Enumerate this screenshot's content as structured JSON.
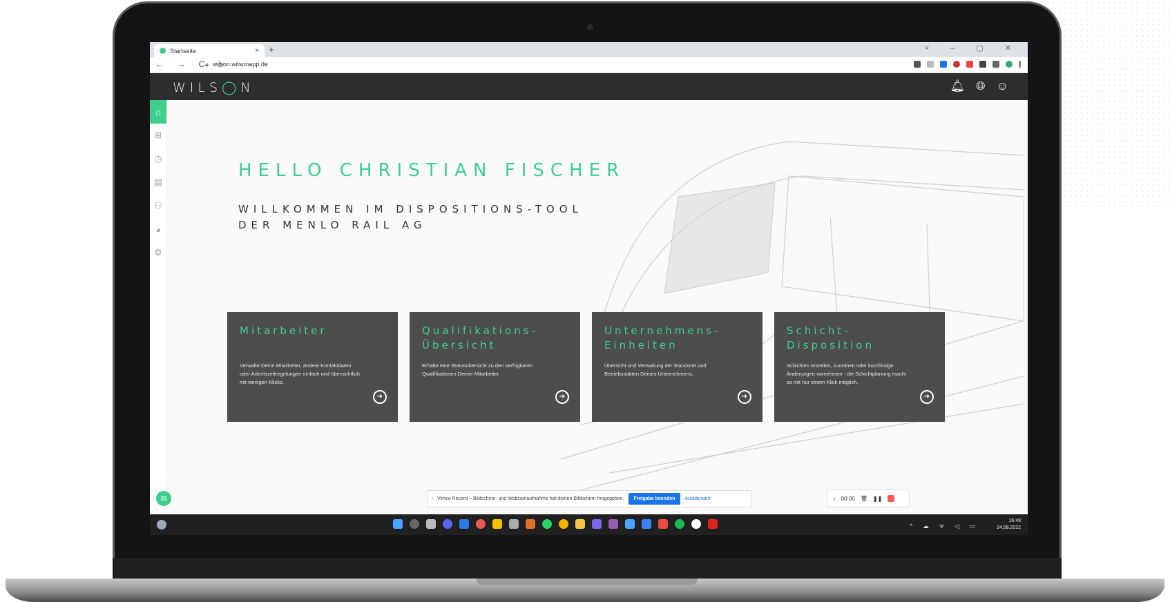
{
  "browser": {
    "tab_title": "Startseite",
    "tab_close": "×",
    "new_tab": "+",
    "url": "wilson.wilsonapp.de",
    "nav": "← → C ⌂",
    "window_controls": "˅ – ▢ ✕"
  },
  "app": {
    "logo_pre": "WILS",
    "logo_o": "◯",
    "logo_post": "N"
  },
  "main": {
    "greeting": "HELLO CHRISTIAN FISCHER",
    "welcome_line1": "WILLKOMMEN IM DISPOSITIONS-TOOL",
    "welcome_line2": "DER MENLO RAIL AG"
  },
  "cards": [
    {
      "title": "Mitarbeiter",
      "text": "Verwalte Deine Mitarbeiter, ändere Kontaktdaten oder Arbeitszeitregelungen einfach und übersichtlich mit wenigen Klicks."
    },
    {
      "title": "Qualifikations-Übersicht",
      "text": "Erhalte eine Statusübersicht zu den verfügbaren Qualifikationen Deiner Mitarbeiter."
    },
    {
      "title": "Unternehmens-Einheiten",
      "text": "Übersicht und Verwaltung der Standorte und Betriebsstätten Deines Unternehmens."
    },
    {
      "title": "Schicht-Disposition",
      "text": "Schichten erstellen, zuordnen oder kurzfristige Änderungen vornehmen - die Schichtplanung macht es mit nur einem Klick möglich."
    }
  ],
  "vimeo": {
    "message": "Vimeo Record – Bildschirm- und Webcamaufnahme hat deinen Bildschirm freigegeben.",
    "stop_button": "Freigabe beenden",
    "hide_button": "Ausblenden",
    "timer": "00:00"
  },
  "taskbar": {
    "time": "16:49",
    "date": "24.08.2022"
  },
  "colors": {
    "accent": "#3ecf8e",
    "header": "#2d2d2d",
    "card": "#4d4d4d"
  }
}
